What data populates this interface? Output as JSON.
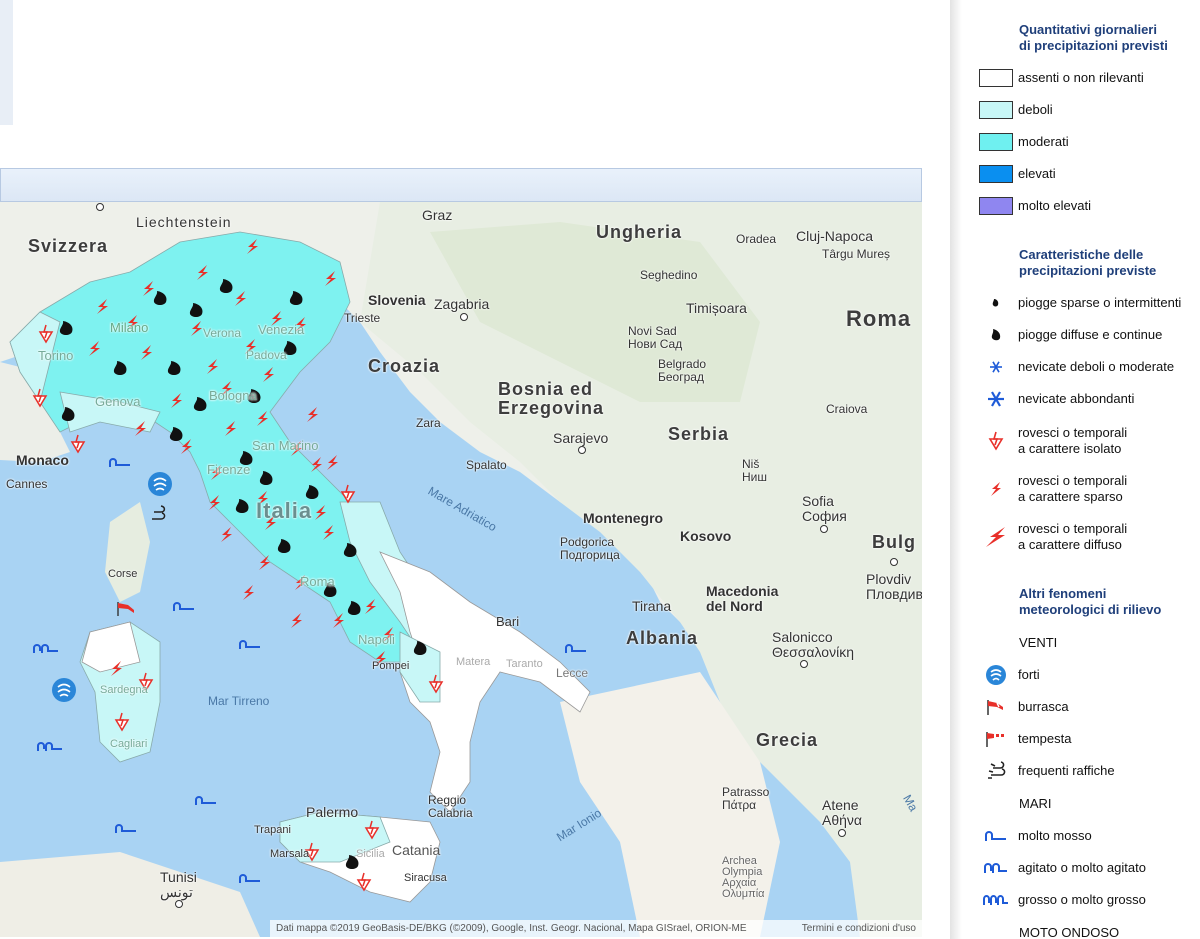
{
  "map": {
    "countries": {
      "svizzera": "Svizzera",
      "liechtenstein": "Liechtenstein",
      "ungheria": "Ungheria",
      "slovenia": "Slovenia",
      "croazia": "Croazia",
      "bosnia": "Bosnia ed\nErzegovina",
      "serbia": "Serbia",
      "montenegro": "Montenegro",
      "kosovo": "Kosovo",
      "albania": "Albania",
      "macedonia": "Macedonia\ndel Nord",
      "grecia": "Grecia",
      "romania": "Roma",
      "bulgaria": "Bulg",
      "monaco": "Monaco",
      "italia": "Italia"
    },
    "cities": {
      "graz": "Graz",
      "oradea": "Oradea",
      "cluj": "Cluj-Napoca",
      "targu": "Târgu Mureș",
      "seghedino": "Seghedino",
      "timisoara": "Timișoara",
      "zagabria": "Zagabria",
      "trieste": "Trieste",
      "novisad": "Novi Sad\nНови Сад",
      "belgrado": "Belgrado\nБеоград",
      "craiova": "Craiova",
      "zara": "Zara",
      "sarajevo": "Sarajevo",
      "spalato": "Spalato",
      "nis": "Niš\nНиш",
      "sofia": "Sofia\nСофия",
      "podgorica": "Podgorica\nПодгорица",
      "plovdiv": "Plovdiv\nПловдив",
      "tirana": "Tirana",
      "salonicco": "Salonicco\nΘεσσαλονίκη",
      "bari": "Bari",
      "lecce": "Lecce",
      "taranto": "Taranto",
      "matera": "Matera",
      "napoli": "Napoli",
      "pompei": "Pompei",
      "roma": "Roma",
      "firenze": "Firenze",
      "sanmarino": "San Marino",
      "bologna": "Bologna",
      "genova": "Genova",
      "milano": "Milano",
      "torino": "Torino",
      "verona": "Verona",
      "venezia": "Venezia",
      "padova": "Padova",
      "cannes": "Cannes",
      "corse": "Corse",
      "sardegna": "Sardegna",
      "cagliari": "Cagliari",
      "palermo": "Palermo",
      "trapani": "Trapani",
      "marsala": "Marsala",
      "catania": "Catania",
      "siracusa": "Siracusa",
      "sicilia": "Sicilia",
      "reggio": "Reggio\nCalabria",
      "tunisi": "Tunisi\nتونس",
      "patrasso": "Patrasso\nΠάτρα",
      "atene": "Atene\nΑθήνα",
      "archea": "Archea\nOlympia\nΑρχαία\nΟλυμπία"
    },
    "seas": {
      "adriatico": "Mare Adriatico",
      "tirreno": "Mar Tirreno",
      "ionio": "Mar Ionio",
      "ma": "Ma"
    },
    "attribution": "Dati mappa ©2019 GeoBasis-DE/BKG (©2009), Google, Inst. Geogr. Nacional, Mapa GISrael, ORION-ME",
    "terms": "Termini e condizioni d'uso"
  },
  "legend": {
    "precip_title": "Quantitativi giornalieri\ndi precipitazioni previsti",
    "precip_items": [
      {
        "label": "assenti o non rilevanti",
        "color": "#ffffff"
      },
      {
        "label": "deboli",
        "color": "#c8f7f7"
      },
      {
        "label": "moderati",
        "color": "#6ff0f0"
      },
      {
        "label": "elevati",
        "color": "#0a8ff0"
      },
      {
        "label": "molto elevati",
        "color": "#8f86f0"
      }
    ],
    "char_title": "Caratteristiche delle\nprecipitazioni previste",
    "char_items": [
      {
        "label": "piogge sparse o intermittenti",
        "icon": "small-drop-icon"
      },
      {
        "label": "piogge diffuse e continue",
        "icon": "drop-icon"
      },
      {
        "label": "nevicate deboli o moderate",
        "icon": "snowflake-small-icon"
      },
      {
        "label": "nevicate abbondanti",
        "icon": "snowflake-icon"
      },
      {
        "label": "rovesci o temporali\na carattere isolato",
        "icon": "isolated-storm-icon"
      },
      {
        "label": "rovesci o temporali\na carattere sparso",
        "icon": "scattered-storm-icon"
      },
      {
        "label": "rovesci o temporali\na carattere diffuso",
        "icon": "widespread-storm-icon"
      }
    ],
    "other_title": "Altri fenomeni\nmeteorologici di rilievo",
    "venti_label": "VENTI",
    "wind_items": [
      {
        "label": "forti",
        "icon": "strong-wind-icon"
      },
      {
        "label": "burrasca",
        "icon": "gale-icon"
      },
      {
        "label": "tempesta",
        "icon": "storm-wind-icon"
      },
      {
        "label": "frequenti raffiche",
        "icon": "gusts-icon"
      }
    ],
    "mari_label": "MARI",
    "sea_items": [
      {
        "label": "molto mosso",
        "icon": "wave-1-icon"
      },
      {
        "label": "agitato o molto agitato",
        "icon": "wave-2-icon"
      },
      {
        "label": "grosso o molto grosso",
        "icon": "wave-3-icon"
      }
    ],
    "moto_label": "MOTO ONDOSO"
  }
}
